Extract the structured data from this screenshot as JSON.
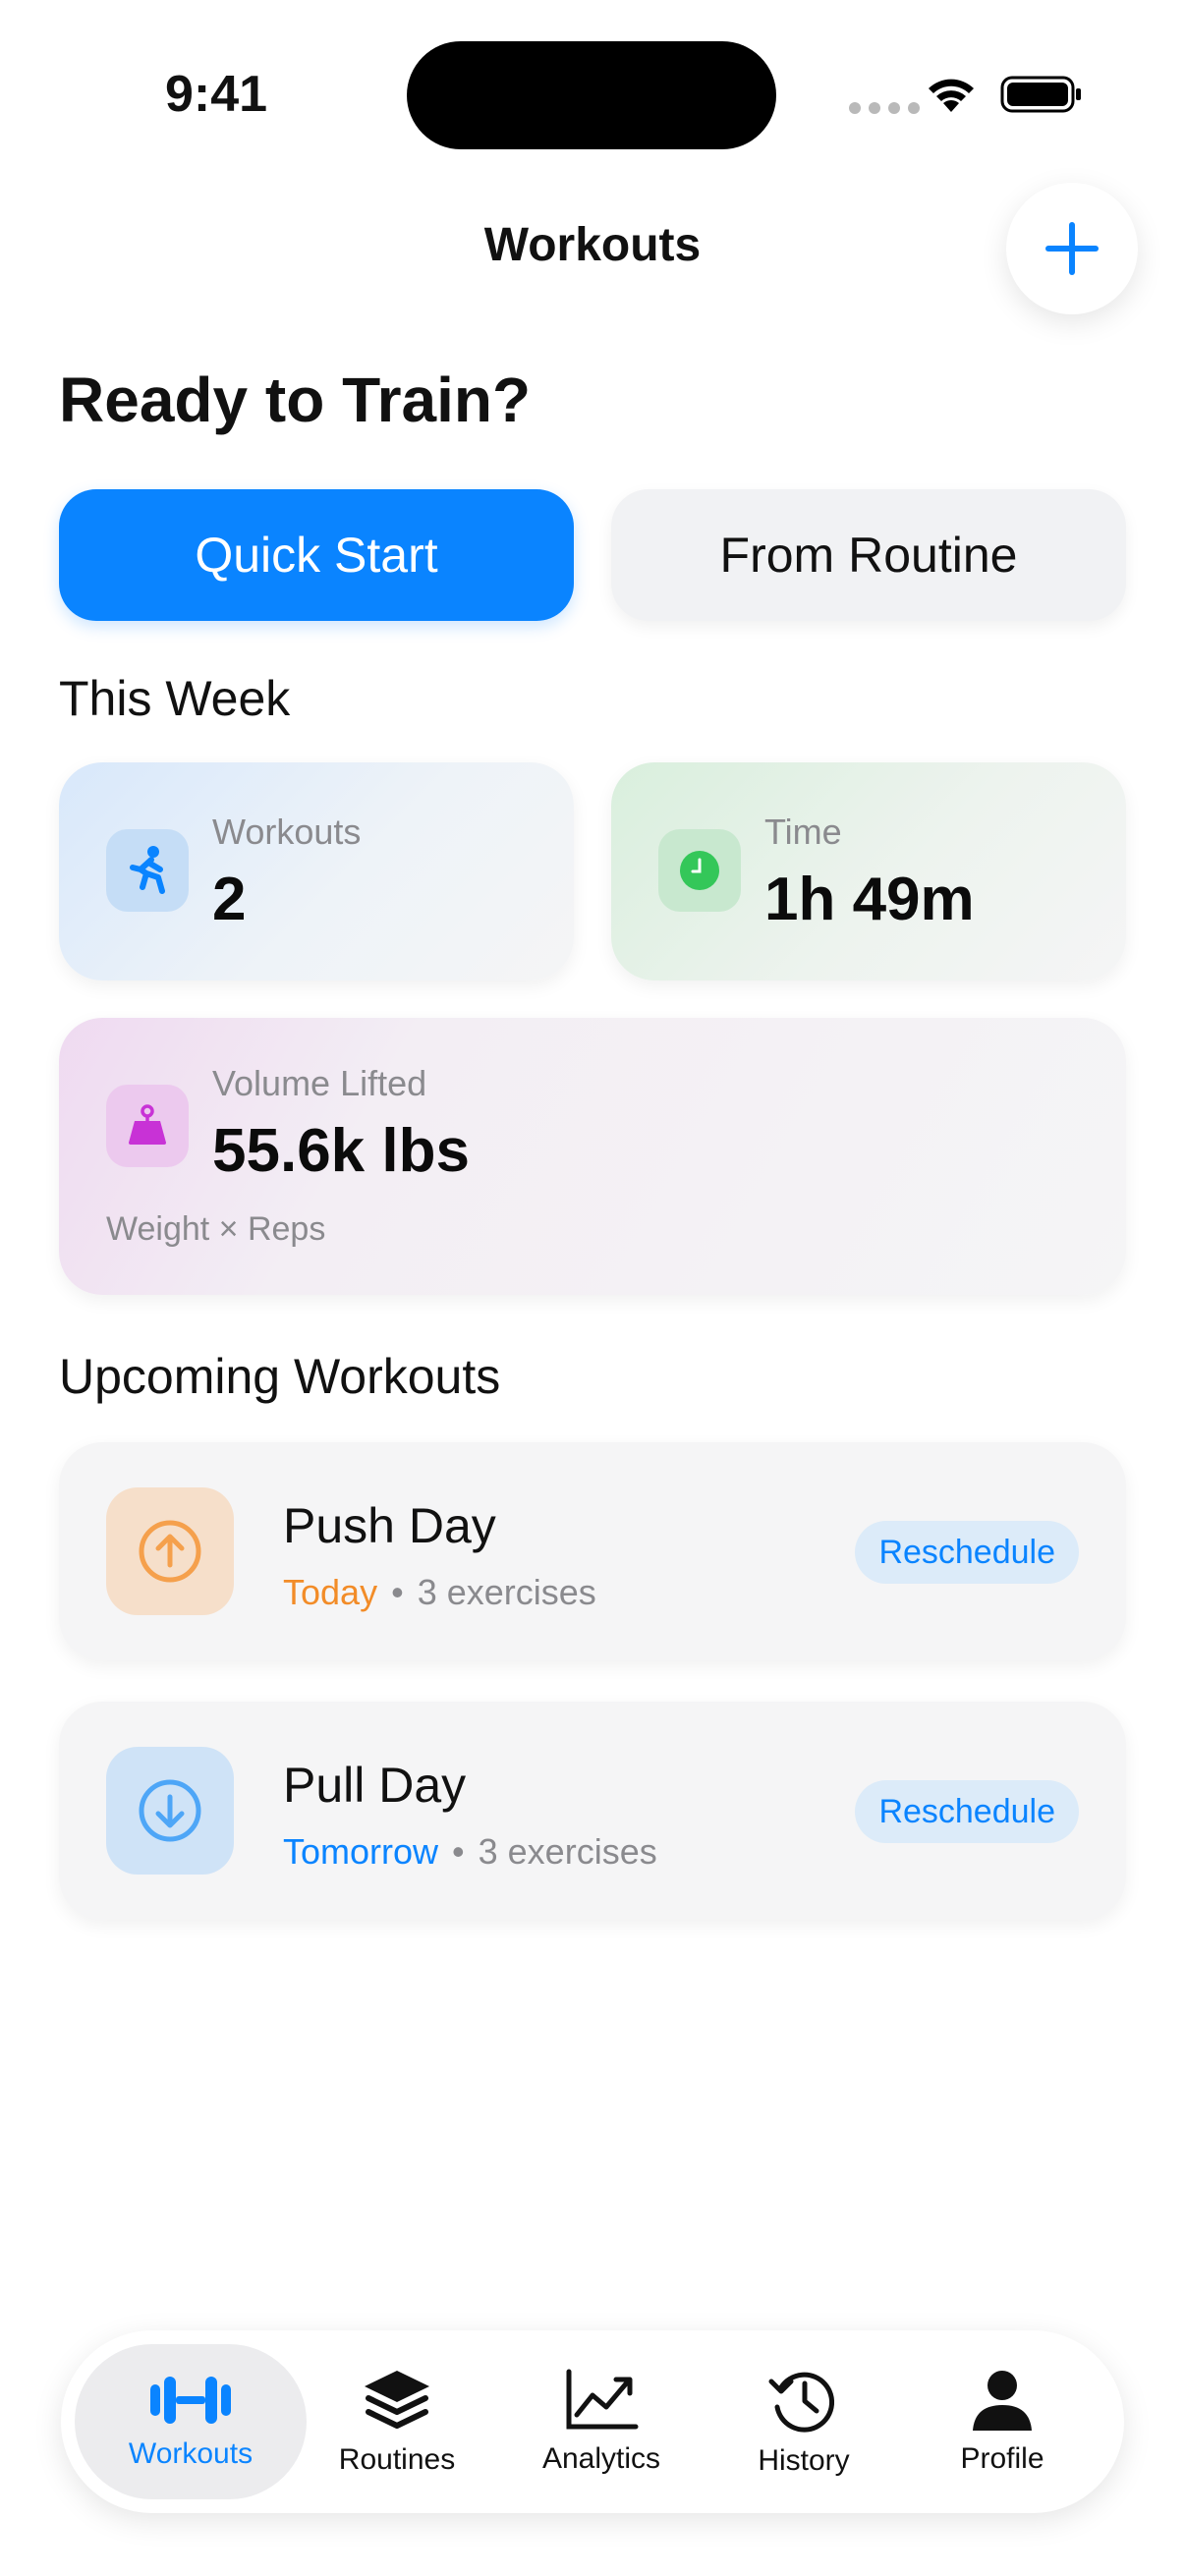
{
  "status_bar": {
    "time": "9:41"
  },
  "header": {
    "title": "Workouts",
    "add_icon": "plus-icon"
  },
  "hero": {
    "title": "Ready to Train?"
  },
  "actions": {
    "quick_start": "Quick Start",
    "from_routine": "From Routine"
  },
  "this_week": {
    "title": "This Week",
    "workouts": {
      "label": "Workouts",
      "value": "2",
      "icon": "running-figure-icon"
    },
    "time": {
      "label": "Time",
      "value": "1h 49m",
      "icon": "clock-icon"
    },
    "volume": {
      "label": "Volume Lifted",
      "value": "55.6k lbs",
      "sub": "Weight × Reps",
      "icon": "kettlebell-icon"
    }
  },
  "upcoming": {
    "title": "Upcoming Workouts",
    "items": [
      {
        "name": "Push Day",
        "when": "Today",
        "exercises": "3 exercises",
        "action": "Reschedule",
        "when_color": "#f28c28",
        "icon": "arrow-up-circle-icon"
      },
      {
        "name": "Pull Day",
        "when": "Tomorrow",
        "exercises": "3 exercises",
        "action": "Reschedule",
        "when_color": "#0a84ff",
        "icon": "arrow-down-circle-icon"
      }
    ]
  },
  "tabs": [
    {
      "label": "Workouts",
      "icon": "dumbbell-icon",
      "active": true
    },
    {
      "label": "Routines",
      "icon": "layers-icon",
      "active": false
    },
    {
      "label": "Analytics",
      "icon": "trend-chart-icon",
      "active": false
    },
    {
      "label": "History",
      "icon": "history-clock-icon",
      "active": false
    },
    {
      "label": "Profile",
      "icon": "person-icon",
      "active": false
    }
  ],
  "colors": {
    "accent": "#0a84ff",
    "orange": "#f28c28",
    "green": "#34c759",
    "purple": "#c832d6"
  }
}
